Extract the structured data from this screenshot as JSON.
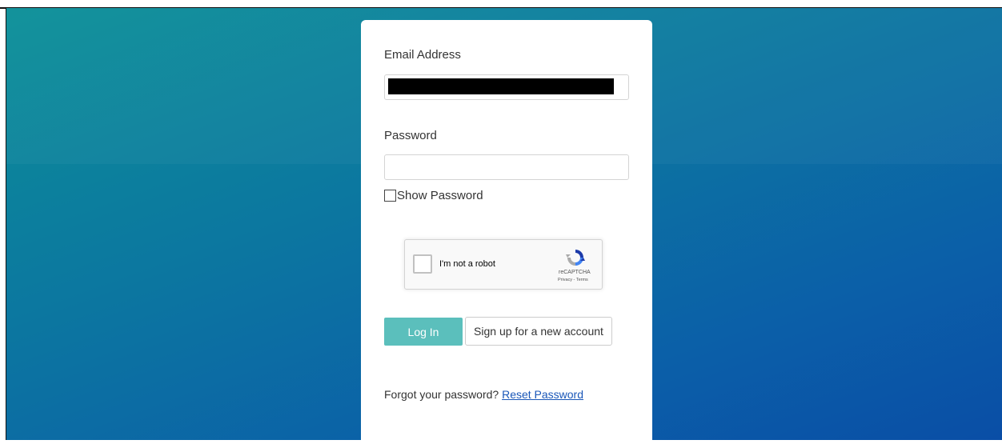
{
  "login": {
    "email_label": "Email Address",
    "email_value": "",
    "password_label": "Password",
    "password_value": "",
    "show_password_label": "Show Password",
    "recaptcha_text": "I'm not a robot",
    "recaptcha_brand": "reCAPTCHA",
    "recaptcha_links": "Privacy - Terms",
    "login_button": "Log In",
    "signup_button": "Sign up for a new account",
    "forgot_text": "Forgot your password?",
    "reset_link": "Reset Password"
  },
  "colors": {
    "login_button_bg": "#5bbfbc",
    "link": "#1a57b8"
  },
  "icons": {
    "recaptcha_logo": "recaptcha-logo-icon",
    "checkbox": "checkbox-icon"
  }
}
